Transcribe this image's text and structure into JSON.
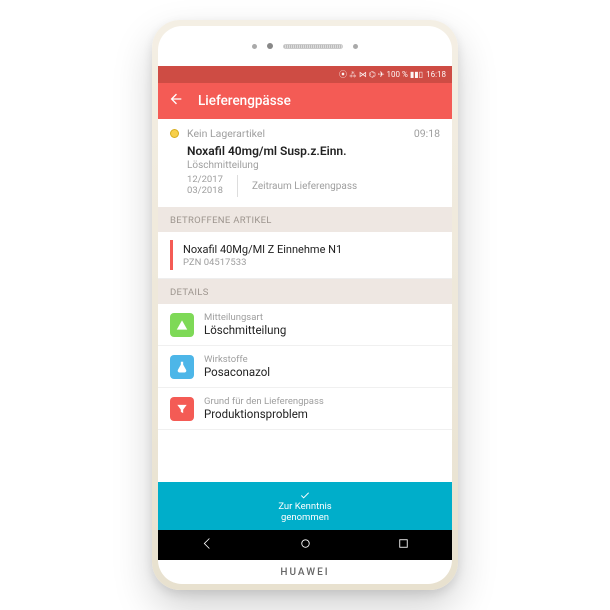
{
  "status_bar": {
    "icons": "⦿ ⁂ ⋈ ⌬ ✈ 100 % ▮▮▯",
    "time": "16:18"
  },
  "app_bar": {
    "title": "Lieferengpässe"
  },
  "item": {
    "stock_status": "Kein Lagerartikel",
    "time": "09:18",
    "product": "Noxafil 40mg/ml Susp.z.Einn.",
    "subtitle": "Löschmitteilung",
    "period_from": "12/2017",
    "period_to": "03/2018",
    "period_label": "Zeitraum Lieferengpass"
  },
  "sections": {
    "affected": "BETROFFENE ARTIKEL",
    "details": "DETAILS"
  },
  "article": {
    "name": "Noxafil 40Mg/Ml Z Einnehme N1",
    "pzn": "PZN 04517533"
  },
  "details": [
    {
      "label": "Mitteilungsart",
      "value": "Löschmitteilung"
    },
    {
      "label": "Wirkstoffe",
      "value": "Posaconazol"
    },
    {
      "label": "Grund für den Lieferengpass",
      "value": "Produktionsproblem"
    }
  ],
  "cta": {
    "line1": "Zur Kenntnis",
    "line2": "genommen"
  },
  "brand": "HUAWEI"
}
